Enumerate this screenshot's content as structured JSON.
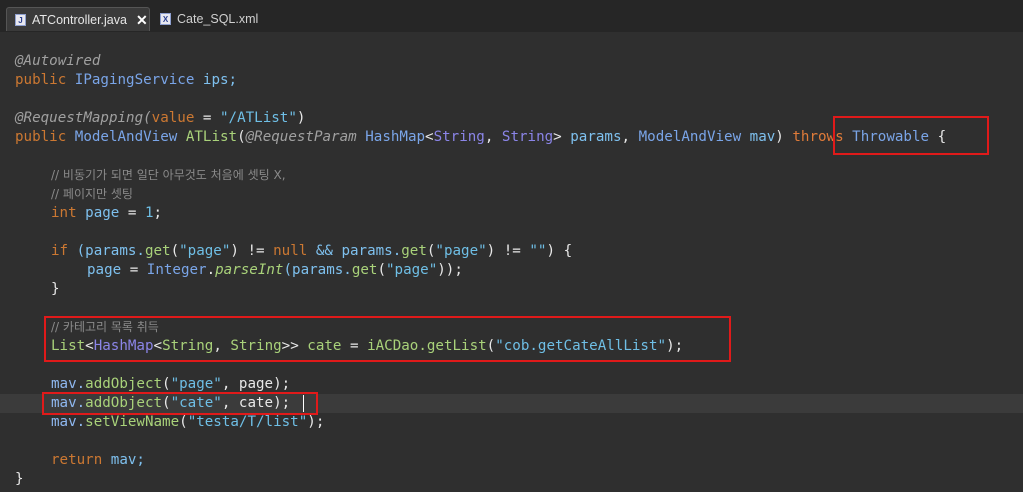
{
  "tabs": [
    {
      "label": "ATController.java",
      "icon": "java-file-icon",
      "active": true,
      "close": "✕"
    },
    {
      "label": "Cate_SQL.xml",
      "icon": "xml-file-icon",
      "active": false
    }
  ],
  "code": {
    "l1": "@Autowired",
    "l2_kw": "public",
    "l2_type": "IPagingService",
    "l2_rest": " ips;",
    "l4_ann": "@RequestMapping(",
    "l4_key": "value",
    "l4_eq": " = ",
    "l4_str": "\"/ATList\"",
    "l4_end": ")",
    "l5_kw": "public",
    "l5_type": "ModelAndView",
    "l5_name": "ATList",
    "l5_p1": "(",
    "l5_ann": "@RequestParam",
    "l5_t1": "HashMap",
    "l5_lt": "<",
    "l5_t2": "String",
    "l5_c1": ", ",
    "l5_t3": "String",
    "l5_gt": ">",
    "l5_v1": "params",
    "l5_c2": ", ",
    "l5_t4": "ModelAndView",
    "l5_v2": "mav",
    "l5_p2": ")",
    "l5_throws": "throws",
    "l5_throwable": "Throwable",
    "l5_brace": " {",
    "c1": "// 비동기가 되면 일단 아무것도 처음에 셋팅 X,",
    "c2": "// 페이지만 셋팅",
    "l8_kw": "int",
    "l8_var": "page",
    "l8_eq": " = ",
    "l8_num": "1",
    "l8_end": ";",
    "l10_if": "if",
    "l10_a": " (params.",
    "l10_get1": "get",
    "l10_s1": "\"page\"",
    "l10_b": ") != ",
    "l10_null": "null",
    "l10_c": " && params.",
    "l10_get2": "get",
    "l10_s2": "\"page\"",
    "l10_d": ") != ",
    "l10_s3": "\"\"",
    "l10_e": ") {",
    "l11_var": "page",
    "l11_eq": " = ",
    "l11_type": "Integer",
    "l11_dot": ".",
    "l11_m": "parseInt",
    "l11_a": "(params.",
    "l11_get": "get",
    "l11_s": "\"page\"",
    "l11_end": "));",
    "l12": "}",
    "c3": "// 카테고리 목록 취득",
    "l15_list": "List",
    "l15_lt": "<",
    "l15_hm": "HashMap",
    "l15_lt2": "<",
    "l15_s1": "String",
    "l15_c": ", ",
    "l15_s2": "String",
    "l15_gt": ">> ",
    "l15_var": "cate",
    "l15_eq": " = ",
    "l15_dao": "iACDao.",
    "l15_m": "getList",
    "l15_str": "\"cob.getCateAllList\"",
    "l15_end": ");",
    "l17_obj": "mav.",
    "l17_m": "addObject",
    "l17_s": "\"page\"",
    "l17_end": ", page);",
    "l18_obj": "mav.",
    "l18_m": "addObject",
    "l18_s": "\"cate\"",
    "l18_end": ", cate);",
    "l19_obj": "mav.",
    "l19_m": "setViewName",
    "l19_s": "\"testa/T/list\"",
    "l19_end": ");",
    "l21_kw": "return",
    "l21_rest": " mav;",
    "l22": "}"
  },
  "colors": {
    "highlight": "#e01a1a",
    "background": "#2f2f2f"
  }
}
